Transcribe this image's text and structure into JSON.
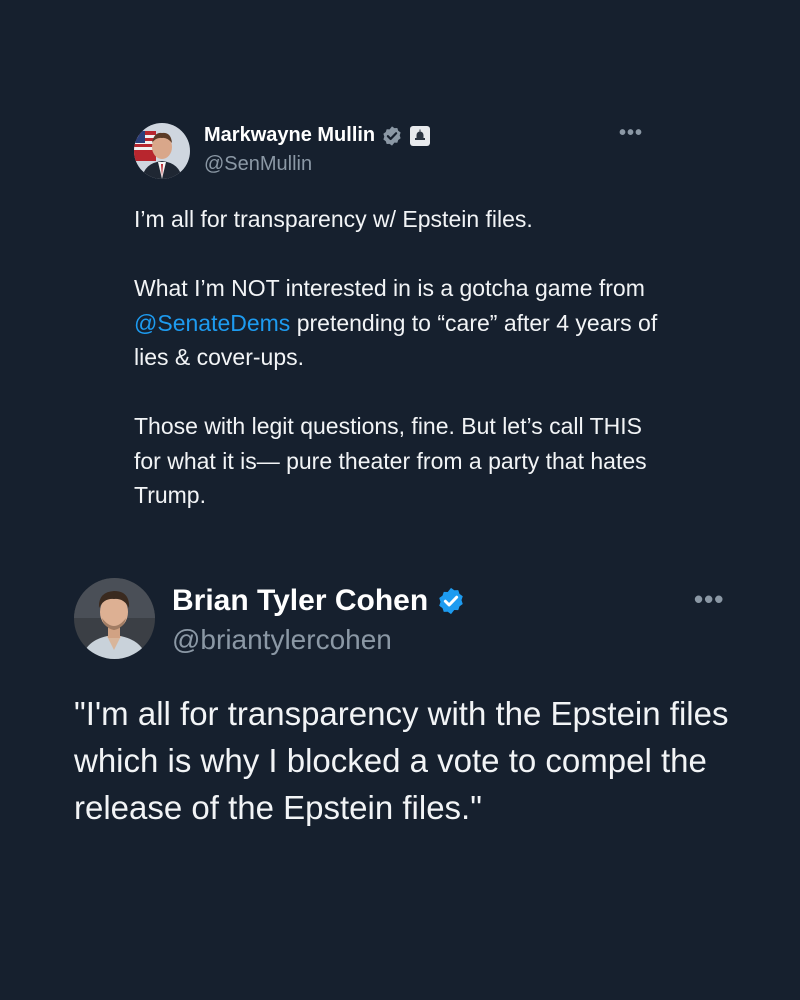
{
  "tweets": [
    {
      "author_name": "Markwayne Mullin",
      "handle": "@SenMullin",
      "more_label": "•••",
      "avatar_icon": "senator-avatar",
      "badges": [
        "verified-badge-gray",
        "government-building-icon"
      ],
      "paragraphs": [
        {
          "text": "I’m all for transparency w/ Epstein files."
        },
        {
          "before": "What I’m NOT interested in is a gotcha game from ",
          "mention": "@SenateDems",
          "after": " pretending to “care” after 4 years of lies & cover-ups."
        },
        {
          "text": "Those with legit questions, fine. But let’s call THIS for what it is— pure theater from a party that hates Trump."
        }
      ]
    },
    {
      "author_name": "Brian Tyler Cohen",
      "handle": "@briantylercohen",
      "more_label": "•••",
      "avatar_icon": "person-avatar",
      "badges": [
        "verified-badge-blue"
      ],
      "text": "\"I'm all for transparency with the Epstein files which is why I blocked a vote to compel the release of the Epstein files.\""
    }
  ],
  "colors": {
    "background": "#16202e",
    "mention": "#1d9bf0",
    "verified_blue": "#1d9bf0",
    "verified_gray": "#8b98a5",
    "secondary_text": "#8b98a5"
  }
}
